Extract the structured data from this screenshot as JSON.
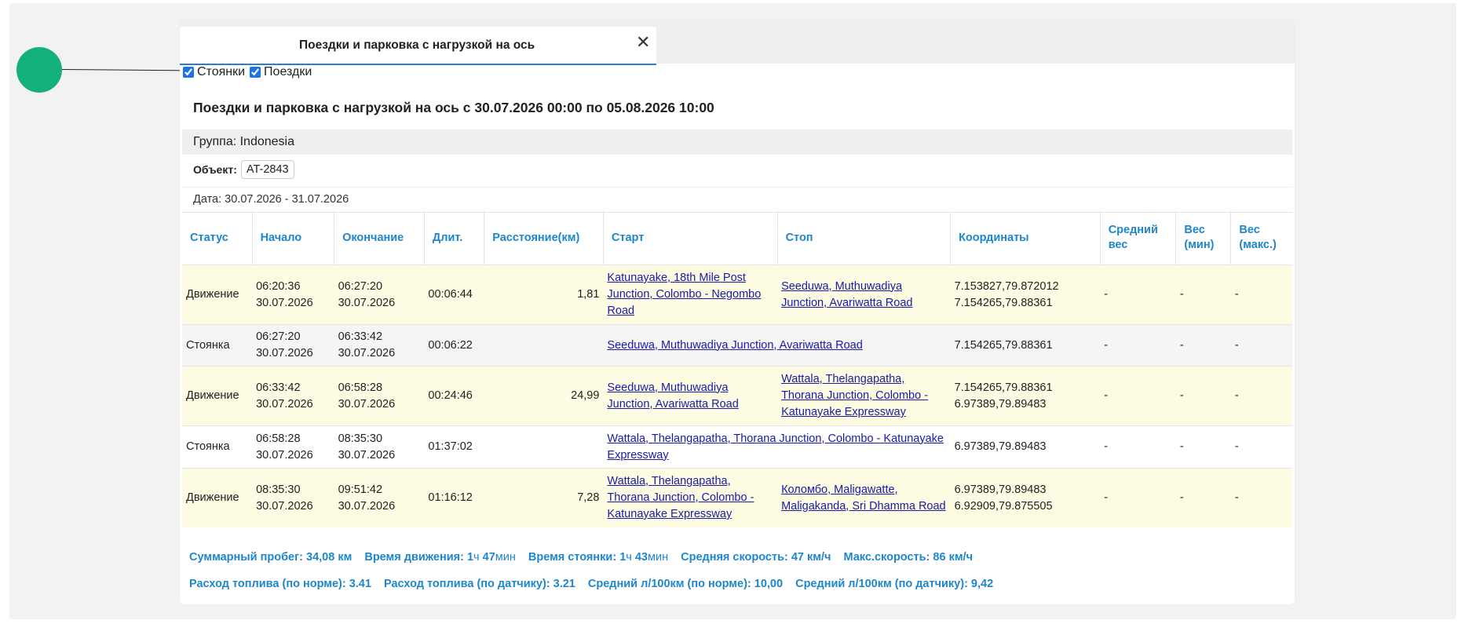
{
  "tab": {
    "title": "Поездки и парковка с нагрузкой на ось",
    "close": "✕"
  },
  "filters": [
    {
      "label": "Стоянки",
      "checked": true
    },
    {
      "label": "Поездки",
      "checked": true
    }
  ],
  "report_title": "Поездки и парковка с нагрузкой на ось с 30.07.2026 00:00 по 05.08.2026 10:00",
  "group": "Группа: Indonesia",
  "object": {
    "label": "Объект:",
    "value": "AT-2843"
  },
  "date_range": "Дата: 30.07.2026 - 31.07.2026",
  "columns": {
    "status": "Статус",
    "start": "Начало",
    "end": "Окончание",
    "duration": "Длит.",
    "distance": "Расстояние(км)",
    "start_addr": "Старт",
    "stop_addr": "Стоп",
    "coords": "Координаты",
    "avg_weight": "Средний вес",
    "min_weight": "Вес (мин)",
    "max_weight": "Вес (макс.)"
  },
  "rows": [
    {
      "status": "Движение",
      "start_time": "06:20:36",
      "start_date": "30.07.2026",
      "end_time": "06:27:20",
      "end_date": "30.07.2026",
      "duration": "00:06:44",
      "distance": "1,81",
      "start_addr": "Katunayake, 18th Mile Post Junction, Colombo - Negombo Road",
      "stop_addr": "Seeduwa, Muthuwadiya Junction, Avariwatta Road",
      "coord1": "7.153827,79.872012",
      "coord2": "7.154265,79.88361",
      "avg": "-",
      "min": "-",
      "max": "-"
    },
    {
      "status": "Стоянка",
      "start_time": "06:27:20",
      "start_date": "30.07.2026",
      "end_time": "06:33:42",
      "end_date": "30.07.2026",
      "duration": "00:06:22",
      "address": "Seeduwa, Muthuwadiya Junction, Avariwatta Road",
      "coord1": "7.154265,79.88361",
      "avg": "-",
      "min": "-",
      "max": "-"
    },
    {
      "status": "Движение",
      "start_time": "06:33:42",
      "start_date": "30.07.2026",
      "end_time": "06:58:28",
      "end_date": "30.07.2026",
      "duration": "00:24:46",
      "distance": "24,99",
      "start_addr": "Seeduwa, Muthuwadiya Junction, Avariwatta Road",
      "stop_addr": "Wattala, Thelangapatha, Thorana Junction, Colombo - Katunayake Expressway",
      "coord1": "7.154265,79.88361",
      "coord2": "6.97389,79.89483",
      "avg": "-",
      "min": "-",
      "max": "-"
    },
    {
      "status": "Стоянка",
      "start_time": "06:58:28",
      "start_date": "30.07.2026",
      "end_time": "08:35:30",
      "end_date": "30.07.2026",
      "duration": "01:37:02",
      "address": "Wattala, Thelangapatha, Thorana Junction, Colombo - Katunayake Expressway",
      "coord1": "6.97389,79.89483",
      "avg": "-",
      "min": "-",
      "max": "-"
    },
    {
      "status": "Движение",
      "start_time": "08:35:30",
      "start_date": "30.07.2026",
      "end_time": "09:51:42",
      "end_date": "30.07.2026",
      "duration": "01:16:12",
      "distance": "7,28",
      "start_addr": "Wattala, Thelangapatha, Thorana Junction, Colombo - Katunayake Expressway",
      "stop_addr": "Коломбо, Maligawatte, Maligakanda, Sri Dhamma Road",
      "coord1": "6.97389,79.89483",
      "coord2": "6.92909,79.875505",
      "avg": "-",
      "min": "-",
      "max": "-"
    }
  ],
  "summary_line1": {
    "mileage": "Суммарный пробег: 34,08 км",
    "move_label": "Время движения:",
    "move_h": "1",
    "move_h_unit": "ч",
    "move_m": "47",
    "move_m_unit": "мин",
    "park_label": "Время стоянки:",
    "park_h": "1",
    "park_h_unit": "ч",
    "park_m": "43",
    "park_m_unit": "мин",
    "avg_speed": "Средняя скорость: 47 км/ч",
    "max_speed": "Макс.скорость: 86 км/ч"
  },
  "summary_line2": {
    "fuel_norm": "Расход топлива (по норме): 3.41",
    "fuel_sensor": "Расход топлива (по датчику): 3.21",
    "avg_norm": "Средний л/100км (по норме): 10,00",
    "avg_sensor": "Средний л/100км (по датчику): 9,42"
  }
}
